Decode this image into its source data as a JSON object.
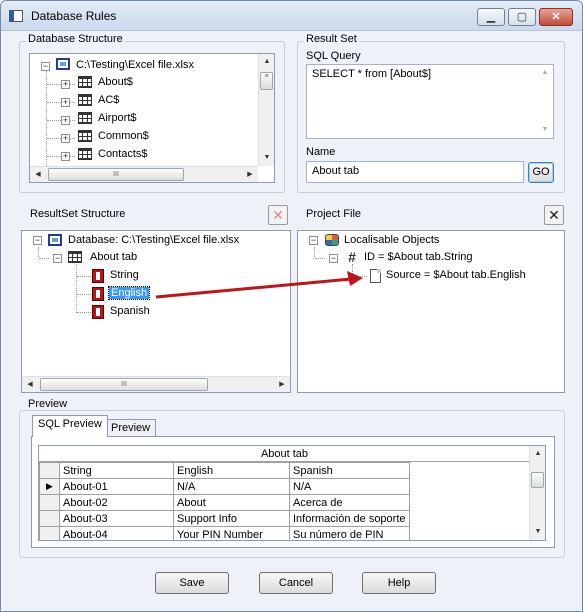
{
  "window": {
    "title": "Database Rules"
  },
  "database_structure": {
    "label": "Database Structure",
    "root": "C:\\Testing\\Excel file.xlsx",
    "tables": [
      "About$",
      "AC$",
      "Airport$",
      "Common$",
      "Contacts$"
    ],
    "hscroll_thumb": "III"
  },
  "result_set": {
    "label": "Result Set",
    "sql_label": "SQL Query",
    "sql_value": "SELECT * from [About$]",
    "name_label": "Name",
    "name_value": "About tab",
    "go_label": "GO"
  },
  "resultset_structure": {
    "label": "ResultSet Structure",
    "root": "Database: C:\\Testing\\Excel file.xlsx",
    "table": "About tab",
    "columns": [
      "String",
      "English",
      "Spanish"
    ],
    "hscroll_thumb": "III"
  },
  "project_file": {
    "label": "Project File",
    "root": "Localisable Objects",
    "id_item": "ID = $About tab.String",
    "source_item": "Source = $About tab.English"
  },
  "preview": {
    "label": "Preview",
    "tabs": [
      "SQL Preview",
      "Preview"
    ],
    "table_title": "About tab",
    "headers": [
      "String",
      "English",
      "Spanish"
    ],
    "rows": [
      [
        "About-01",
        "N/A",
        "N/A"
      ],
      [
        "About-02",
        "About",
        "Acerca de"
      ],
      [
        "About-03",
        "Support Info",
        "Información de soporte"
      ],
      [
        "About-04",
        "Your PIN Number",
        "Su número de PIN"
      ]
    ]
  },
  "buttons": {
    "save": "Save",
    "cancel": "Cancel",
    "help": "Help"
  },
  "colors": {
    "arrow": "#c0141a",
    "selection": "#3399ff"
  }
}
